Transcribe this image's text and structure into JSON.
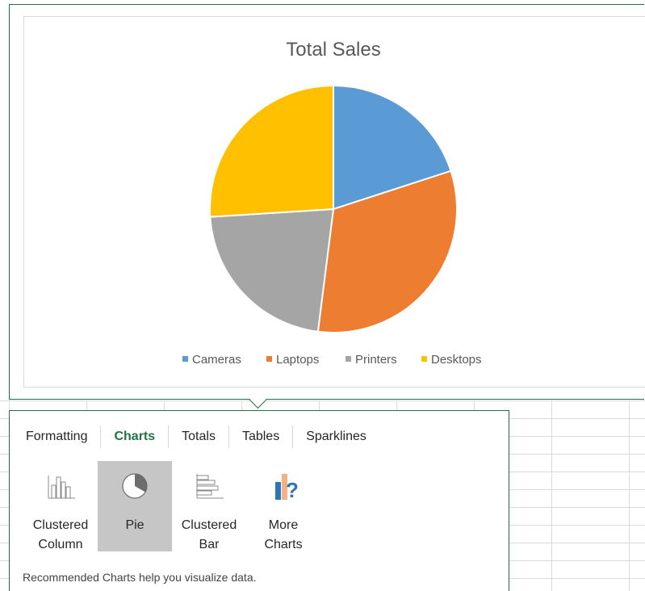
{
  "chart_data": {
    "type": "pie",
    "title": "Total Sales",
    "categories": [
      "Cameras",
      "Laptops",
      "Printers",
      "Desktops"
    ],
    "values": [
      20,
      32,
      22,
      26
    ],
    "colors": [
      "#5b9bd5",
      "#ed7d31",
      "#a5a5a5",
      "#ffc000"
    ],
    "legend_position": "bottom"
  },
  "quick_analysis": {
    "tabs": [
      "Formatting",
      "Charts",
      "Totals",
      "Tables",
      "Sparklines"
    ],
    "active_tab": "Charts",
    "options": [
      {
        "line1": "Clustered",
        "line2": "Column",
        "icon": "clustered-column-chart-icon",
        "selected": false
      },
      {
        "line1": "Pie",
        "line2": "",
        "icon": "pie-chart-icon",
        "selected": true
      },
      {
        "line1": "Clustered",
        "line2": "Bar",
        "icon": "clustered-bar-chart-icon",
        "selected": false
      },
      {
        "line1": "More",
        "line2": "Charts",
        "icon": "more-charts-icon",
        "selected": false
      }
    ],
    "help_text": "Recommended Charts help you visualize data."
  }
}
